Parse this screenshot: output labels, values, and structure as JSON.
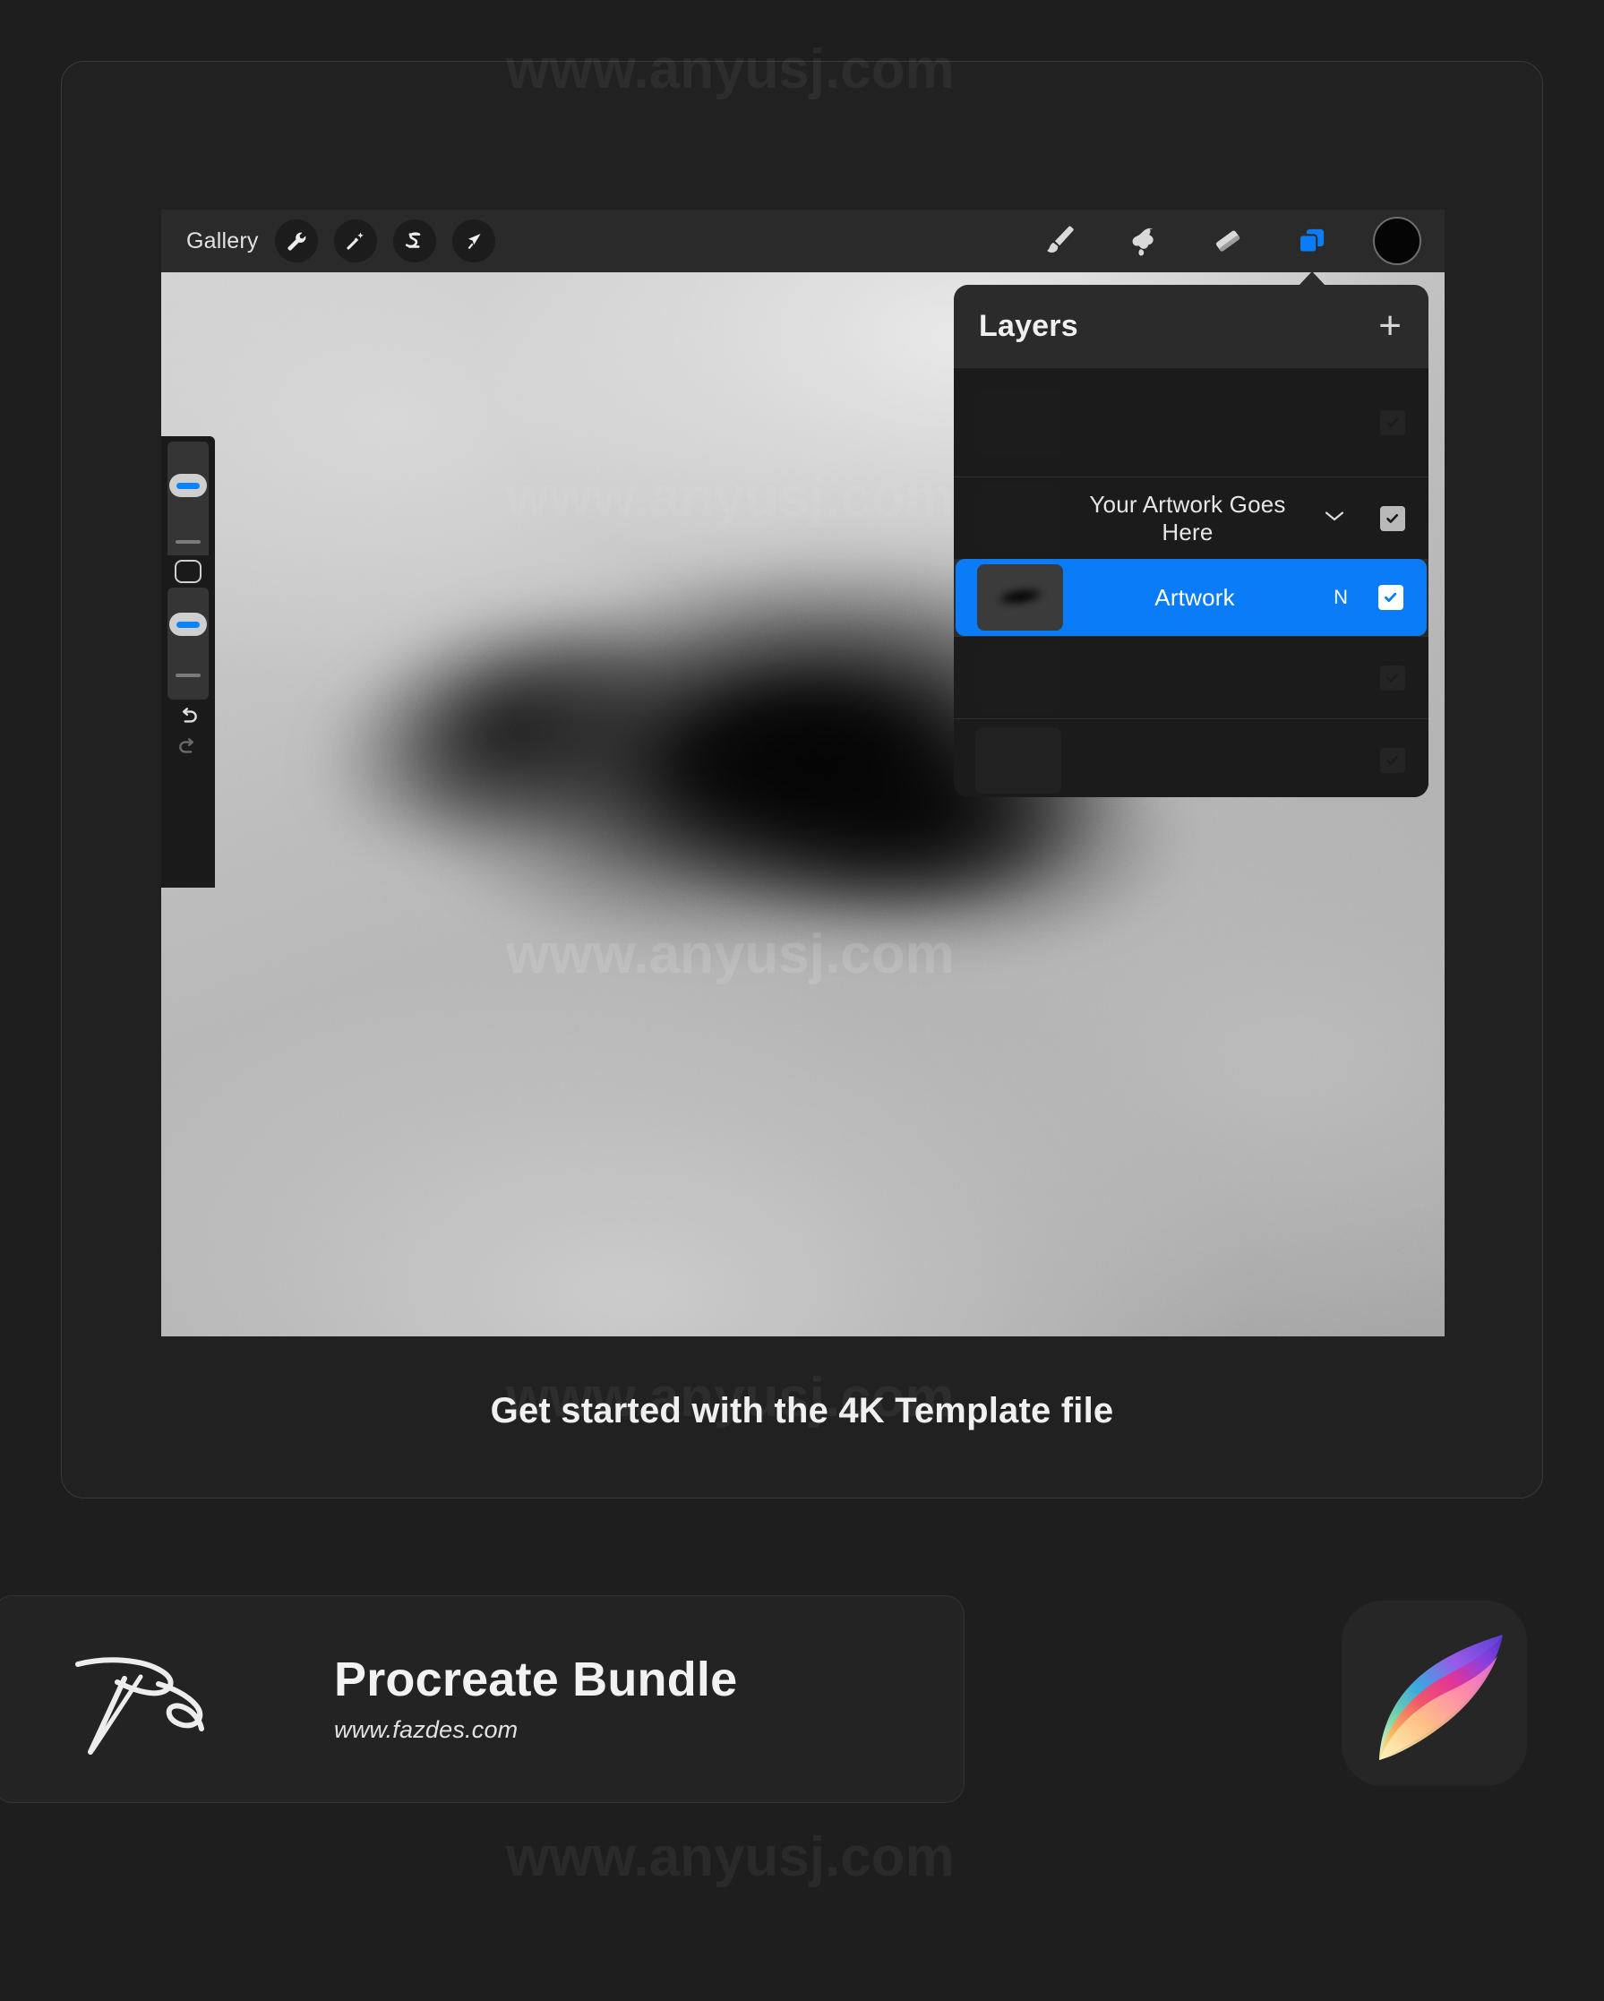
{
  "watermark": {
    "text": "www.anyusj.com"
  },
  "app": {
    "topbar": {
      "gallery_label": "Gallery",
      "left_tools": [
        {
          "name": "wrench-icon",
          "label": "Actions"
        },
        {
          "name": "magic-wand-icon",
          "label": "Adjustments"
        },
        {
          "name": "selection-icon",
          "label": "Selection"
        },
        {
          "name": "transform-arrow-icon",
          "label": "Transform"
        }
      ],
      "right_tools": [
        {
          "name": "paintbrush-icon",
          "label": "Paint"
        },
        {
          "name": "smudge-icon",
          "label": "Smudge"
        },
        {
          "name": "eraser-icon",
          "label": "Erase"
        },
        {
          "name": "layers-icon",
          "label": "Layers"
        }
      ],
      "color_swatch": "#050505"
    },
    "sidebar": {
      "brush_size_label": "Brush size",
      "brush_opacity_label": "Brush opacity",
      "modify_label": "Modify",
      "undo_label": "Undo",
      "redo_label": "Redo"
    }
  },
  "layers_panel": {
    "title": "Layers",
    "add_label": "+",
    "rows": [
      {
        "name": "",
        "mode": "",
        "visible": true,
        "selected": false,
        "dim": true,
        "tall": true
      },
      {
        "name": "Your Artwork Goes Here",
        "mode": "",
        "visible": true,
        "selected": false,
        "dim": false,
        "chevron": "⌄"
      },
      {
        "name": "Artwork",
        "mode": "N",
        "visible": true,
        "selected": true,
        "dim": false
      },
      {
        "name": "",
        "mode": "",
        "visible": true,
        "selected": false,
        "dim": true
      },
      {
        "name": "",
        "mode": "",
        "visible": true,
        "selected": false,
        "dim": true
      }
    ]
  },
  "caption": {
    "text": "Get started with the 4K Template file"
  },
  "brand": {
    "title": "Procreate Bundle",
    "url": "www.fazdes.com",
    "logo_name": "fazdes-signature-logo",
    "app_icon_name": "procreate-app-icon"
  },
  "colors": {
    "accent_blue": "#0a7cf7",
    "slider_blue": "#0a84ff",
    "page_bg": "#1e1e1e",
    "panel_bg": "#2b2b2b",
    "row_bg": "#1b1b1b"
  }
}
